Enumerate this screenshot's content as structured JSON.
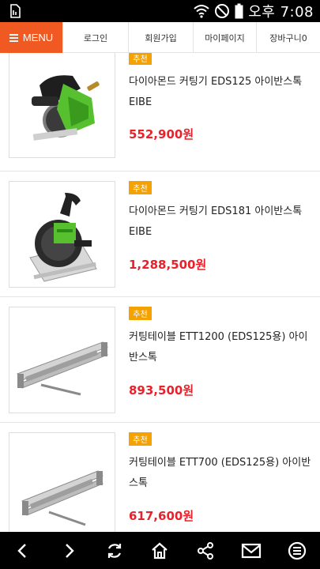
{
  "statusbar": {
    "time": "오후 7:08"
  },
  "nav": {
    "menu_label": "MENU",
    "items": [
      "로그인",
      "회원가입",
      "마이페이지",
      "장바구니0"
    ]
  },
  "products": [
    {
      "badge": "추천",
      "name": "다이아몬드 커팅기 EDS125 아이반스톡 EIBE",
      "price": "552,900원"
    },
    {
      "badge": "추천",
      "name": "다이아몬드 커팅기 EDS181 아이반스톡 EIBE",
      "price": "1,288,500원"
    },
    {
      "badge": "추천",
      "name": "커팅테이블 ETT1200 (EDS125용) 아이반스톡",
      "price": "893,500원"
    },
    {
      "badge": "추천",
      "name": "커팅테이블 ETT700 (EDS125용) 아이반스톡",
      "price": "617,600원"
    }
  ],
  "bottombar": {
    "icons": [
      "back-icon",
      "forward-icon",
      "refresh-icon",
      "home-icon",
      "share-icon",
      "mail-icon",
      "more-icon"
    ]
  },
  "colors": {
    "accent": "#f05a22",
    "badge": "#f5a200",
    "price": "#e8212b"
  }
}
